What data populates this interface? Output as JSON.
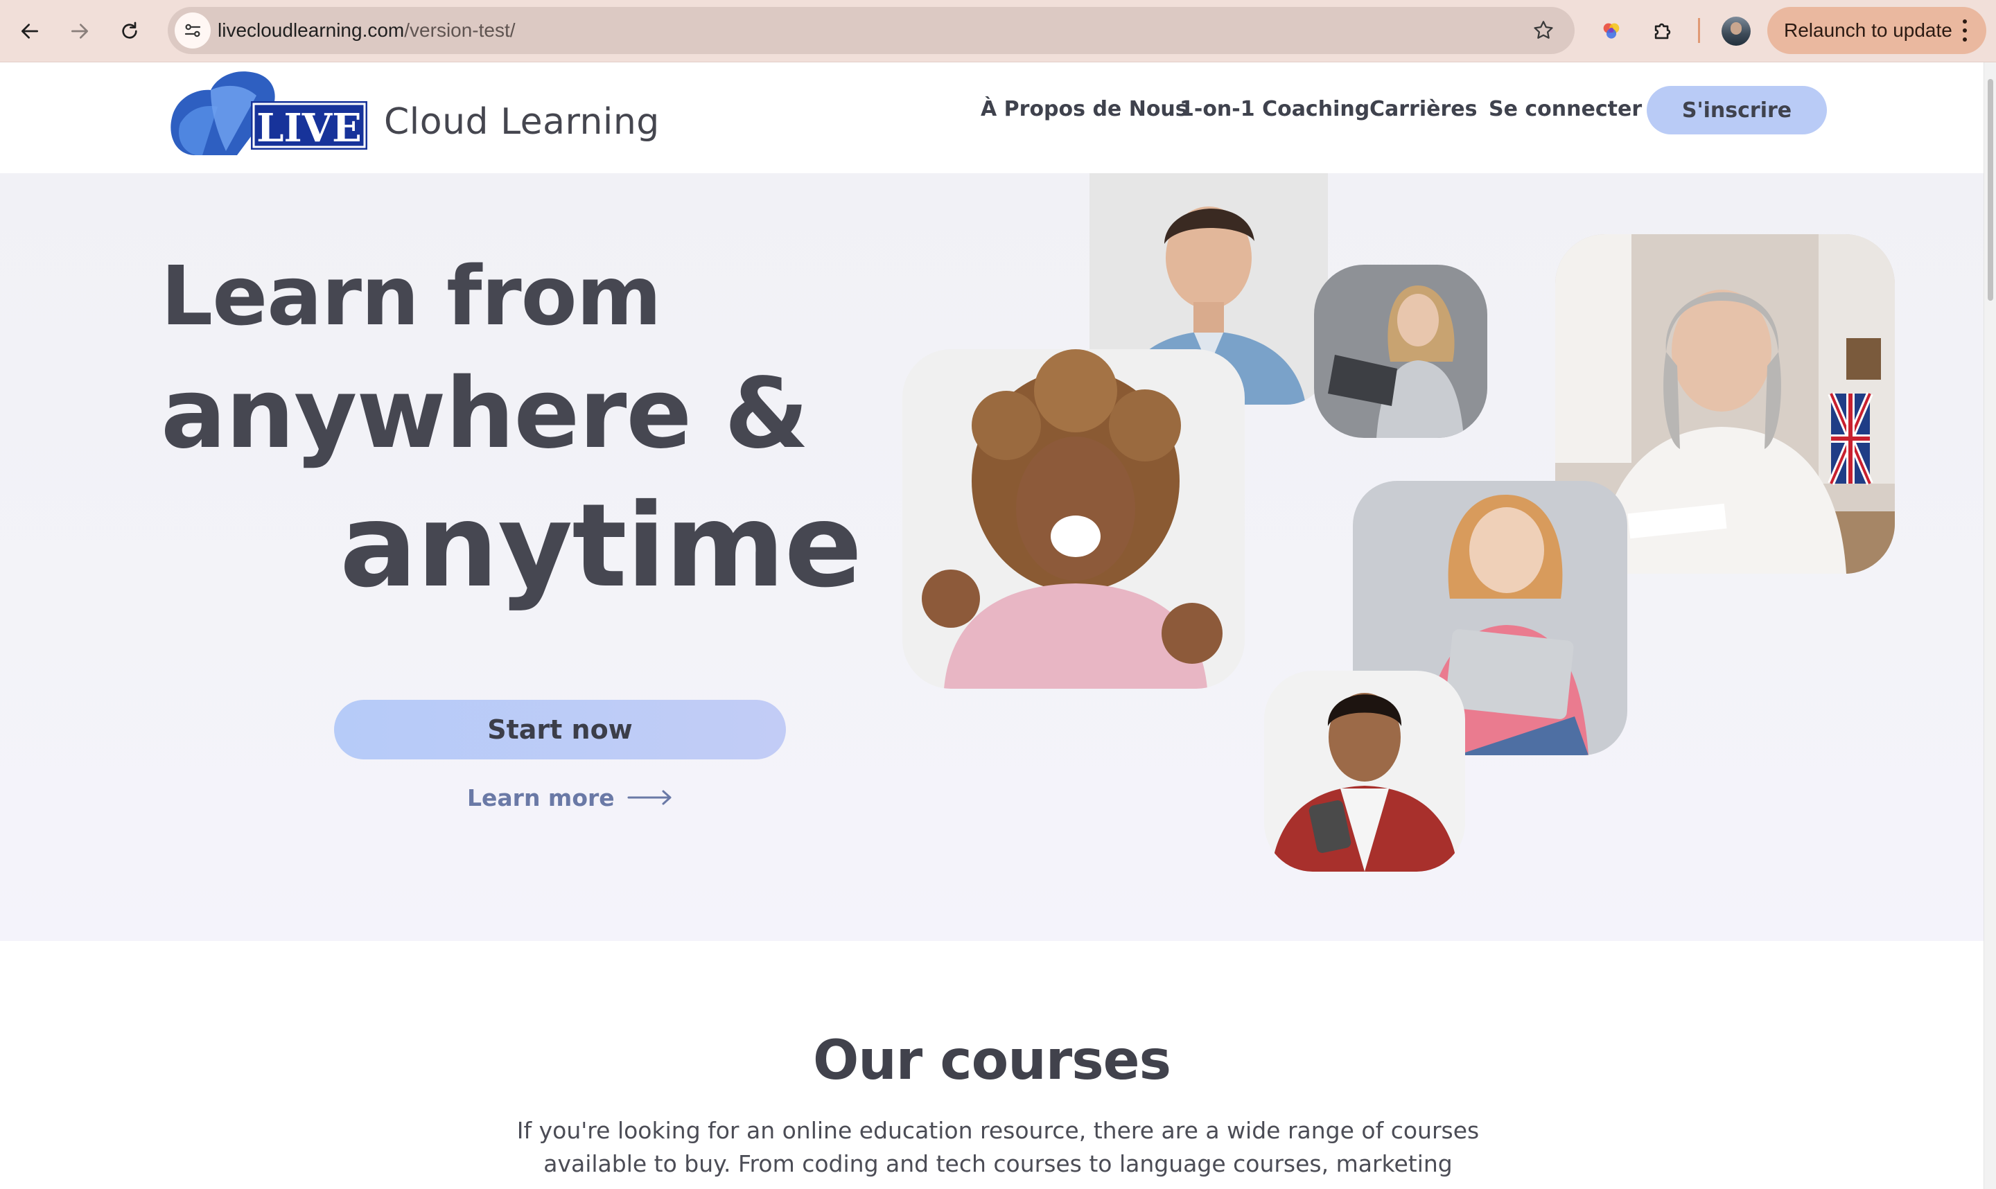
{
  "browser": {
    "url_host": "livecloudlearning.com",
    "url_path": "/version-test/",
    "relaunch_label": "Relaunch to update"
  },
  "header": {
    "logo_text": "LIVE",
    "brand": "Cloud Learning",
    "nav": [
      {
        "label": "À Propos de Nous"
      },
      {
        "label": "1-on-1 Coaching"
      },
      {
        "label": "Carrières"
      },
      {
        "label": "Se connecter"
      }
    ],
    "signup_label": "S'inscrire"
  },
  "hero": {
    "line1": "Learn from",
    "line2": "anywhere &",
    "line3": "anytime",
    "cta": "Start now",
    "learn_more": "Learn more"
  },
  "courses": {
    "title": "Our courses",
    "description": "If you're looking for an online education resource, there are a wide range of courses available to buy. From coding and tech courses to language courses, marketing"
  },
  "colors": {
    "accent": "#b9cbf6",
    "logo_blue": "#2f5fc0",
    "text_dark": "#464751",
    "link": "#6a79a6"
  }
}
